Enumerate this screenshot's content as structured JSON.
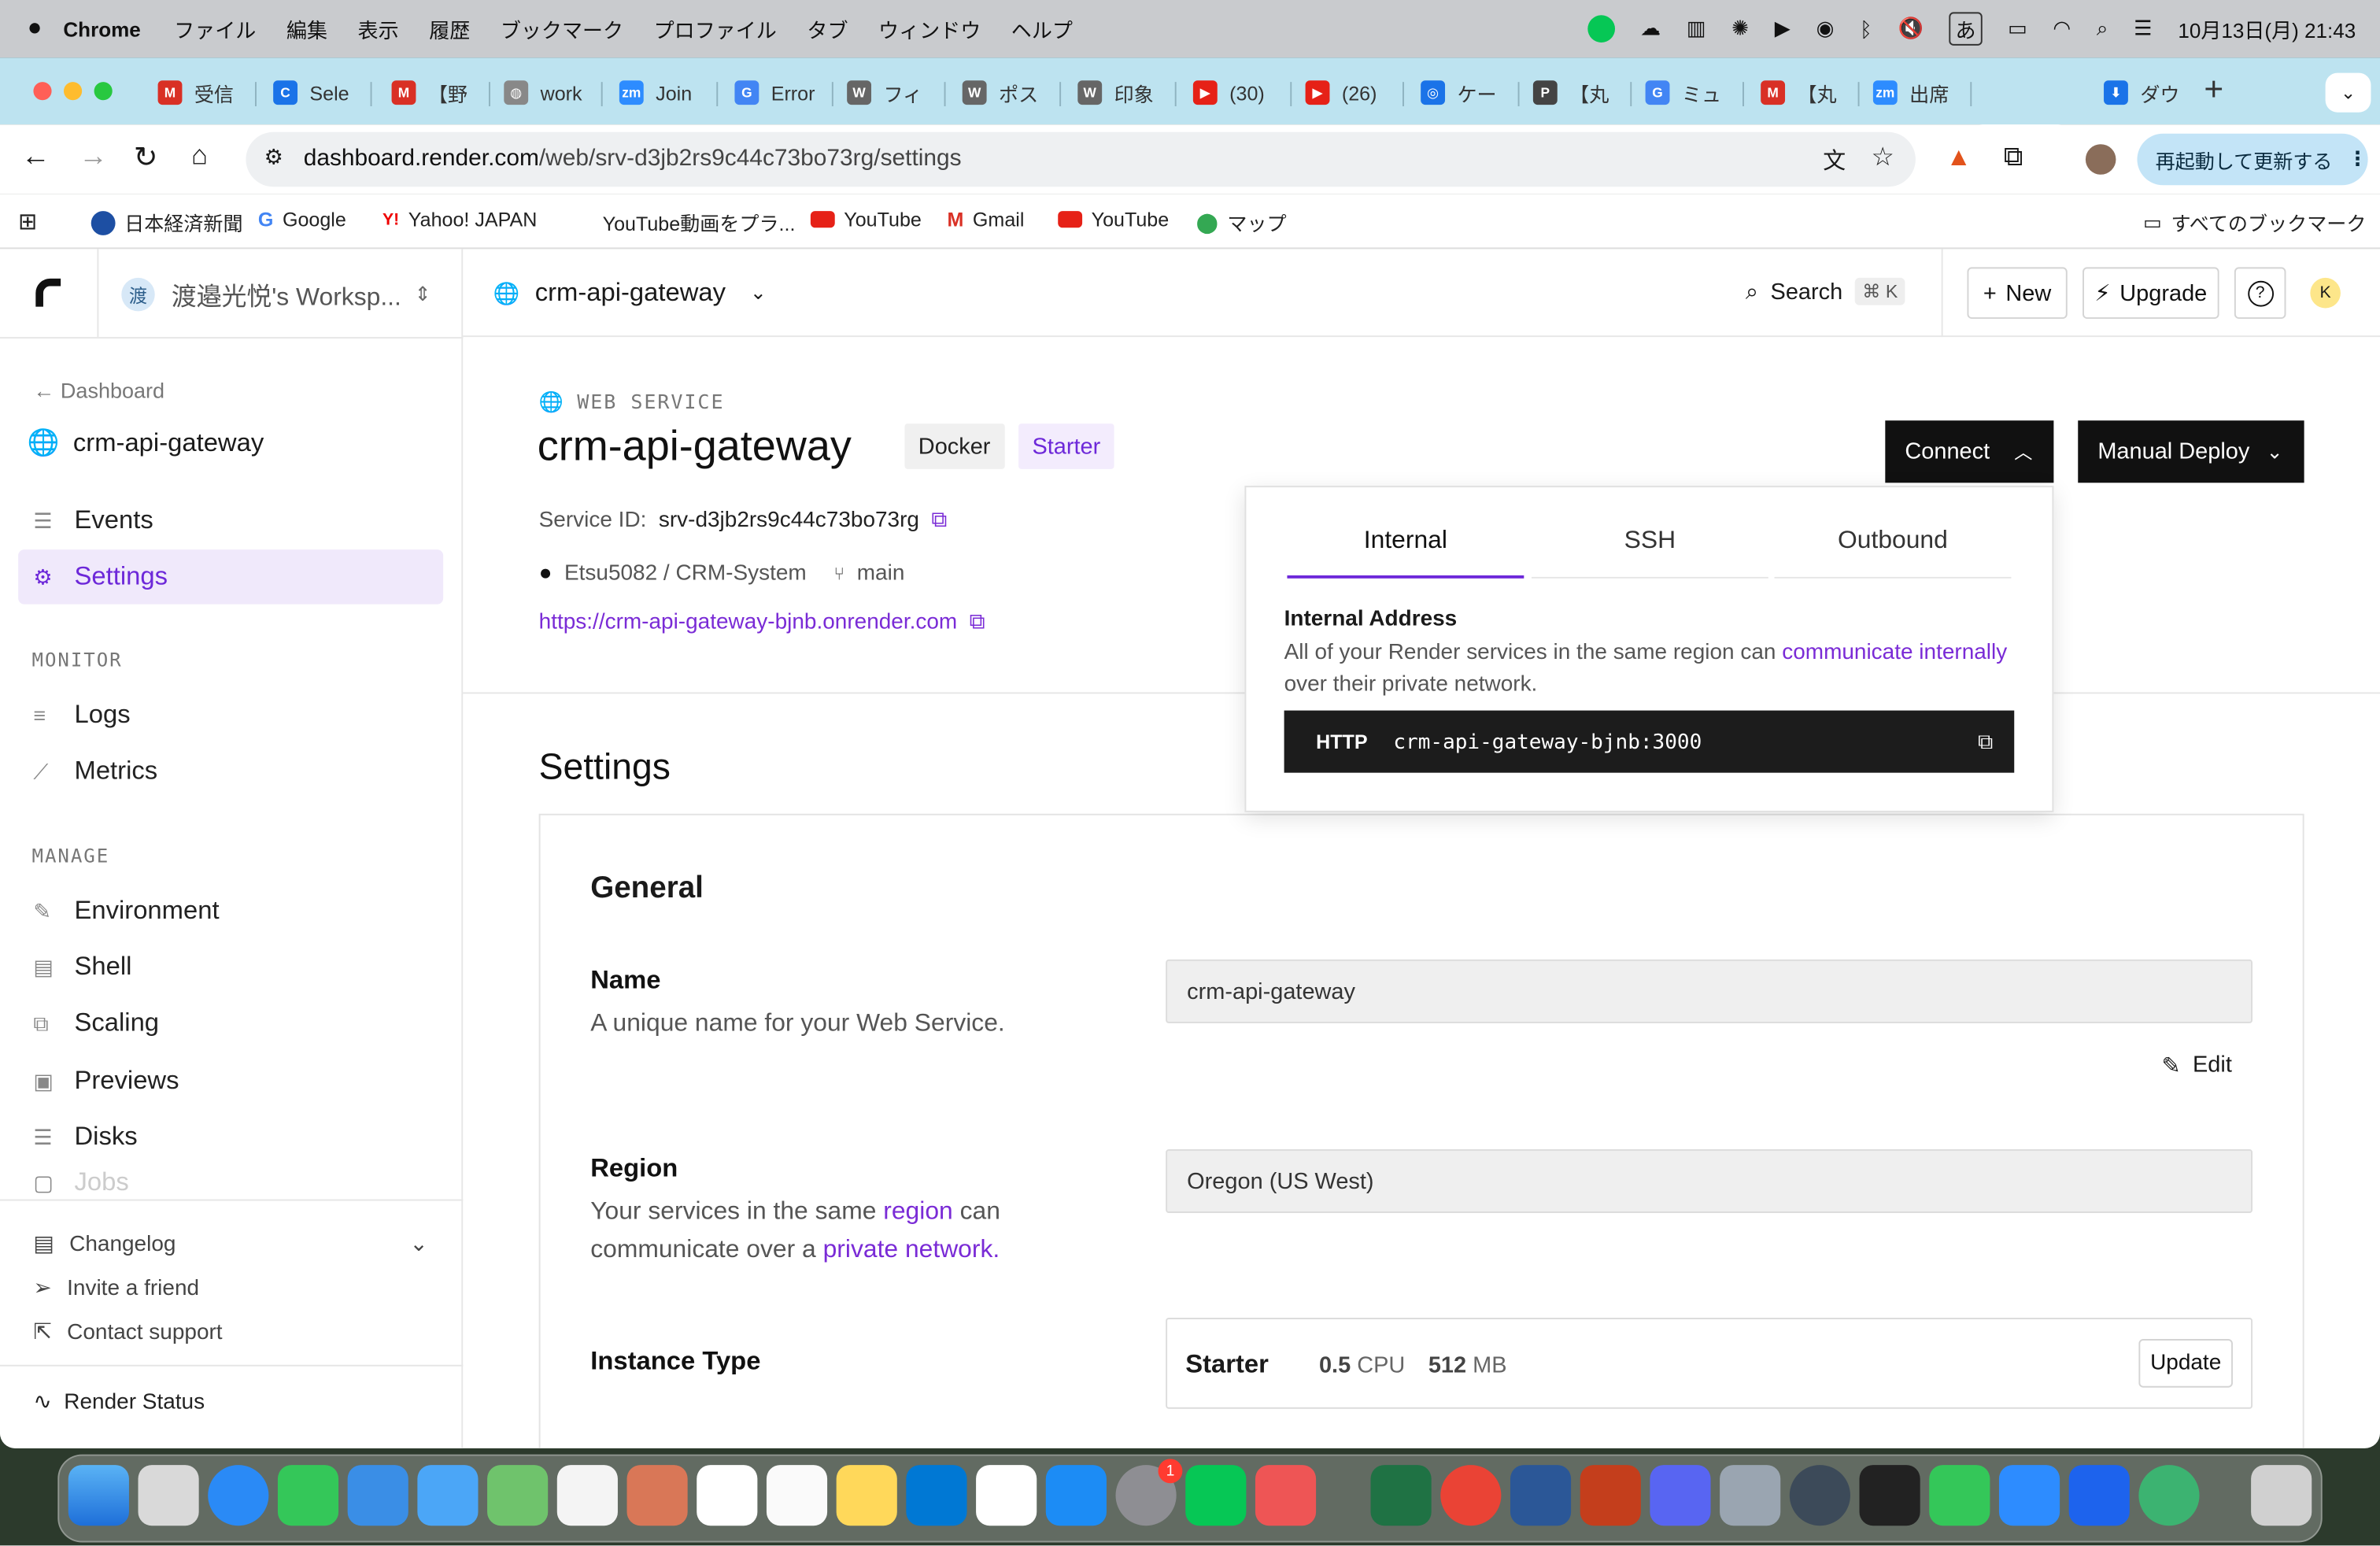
{
  "menubar": {
    "app": "Chrome",
    "items": [
      "ファイル",
      "編集",
      "表示",
      "履歴",
      "ブックマーク",
      "プロファイル",
      "タブ",
      "ウィンドウ",
      "ヘルプ"
    ],
    "ime": "あ",
    "clock": "10月13日(月)  21:43"
  },
  "tabs": [
    {
      "label": "受信",
      "fav": "M",
      "color": "#d93025"
    },
    {
      "label": "Sele",
      "fav": "C",
      "color": "#1a73e8"
    },
    {
      "label": "【野",
      "fav": "M",
      "color": "#d93025"
    },
    {
      "label": "work",
      "fav": "◍",
      "color": "#888"
    },
    {
      "label": "Join",
      "fav": "zm",
      "color": "#2d8cff"
    },
    {
      "label": "Error",
      "fav": "G",
      "color": "#4285f4"
    },
    {
      "label": "フィ",
      "fav": "W",
      "color": "#666"
    },
    {
      "label": "ポス",
      "fav": "W",
      "color": "#666"
    },
    {
      "label": "印象",
      "fav": "W",
      "color": "#666"
    },
    {
      "label": "(30)",
      "fav": "▶",
      "color": "#e62117"
    },
    {
      "label": "(26)",
      "fav": "▶",
      "color": "#e62117"
    },
    {
      "label": "ケー",
      "fav": "◎",
      "color": "#1a73e8"
    },
    {
      "label": "【丸",
      "fav": "P",
      "color": "#444"
    },
    {
      "label": "ミュ",
      "fav": "G",
      "color": "#4285f4"
    },
    {
      "label": "【丸",
      "fav": "M",
      "color": "#d93025"
    },
    {
      "label": "出席",
      "fav": "zm",
      "color": "#2d8cff"
    },
    {
      "label": "(",
      "fav": "▞",
      "color": "#111"
    },
    {
      "label": "ダウ",
      "fav": "⬇",
      "color": "#1a73e8"
    }
  ],
  "toolbar": {
    "url_host": "dashboard.render.com",
    "url_path": "/web/srv-d3jb2rs9c44c73bo73rg/settings",
    "restart": "再起動して更新する"
  },
  "bookmarks": [
    "日本経済新聞",
    "Google",
    "Yahoo! JAPAN",
    "YouTube動画をプラ...",
    "YouTube",
    "Gmail",
    "YouTube",
    "マップ"
  ],
  "bookmarks_all": "すべてのブックマーク",
  "workspace": {
    "initial": "渡",
    "name": "渡邉光悦's Worksp..."
  },
  "topbar": {
    "service": "crm-api-gateway",
    "search": "Search",
    "shortcut": "⌘ K",
    "new": "New",
    "upgrade": "Upgrade",
    "help": "?",
    "avatar": "K"
  },
  "sidebar": {
    "back": "Dashboard",
    "service": "crm-api-gateway",
    "events": "Events",
    "settings": "Settings",
    "monitor": "MONITOR",
    "logs": "Logs",
    "metrics": "Metrics",
    "manage": "MANAGE",
    "environment": "Environment",
    "shell": "Shell",
    "scaling": "Scaling",
    "previews": "Previews",
    "disks": "Disks",
    "jobs": "Jobs",
    "changelog": "Changelog",
    "invite": "Invite a friend",
    "support": "Contact support",
    "status": "Render Status"
  },
  "service": {
    "type": "WEB SERVICE",
    "name": "crm-api-gateway",
    "tag_runtime": "Docker",
    "tag_plan": "Starter",
    "id_label": "Service ID:",
    "id": "srv-d3jb2rs9c44c73bo73rg",
    "repo": "Etsu5082 / CRM-System",
    "branch": "main",
    "url": "https://crm-api-gateway-bjnb.onrender.com"
  },
  "actions": {
    "connect": "Connect",
    "deploy": "Manual Deploy"
  },
  "popover": {
    "tabs": [
      "Internal",
      "SSH",
      "Outbound"
    ],
    "title": "Internal Address",
    "desc_pre": "All of your Render services in the same region can ",
    "desc_link": "communicate internally",
    "desc_post": " over their private network.",
    "protocol": "HTTP",
    "address": "crm-api-gateway-bjnb:3000"
  },
  "settings": {
    "heading": "Settings",
    "general": "General",
    "name_label": "Name",
    "name_desc": "A unique name for your Web Service.",
    "name_value": "crm-api-gateway",
    "edit": "Edit",
    "region_label": "Region",
    "region_d1": "Your services in the same ",
    "region_link1": "region",
    "region_d2": " can communicate over a ",
    "region_link2": "private network.",
    "region_value": "Oregon (US West)",
    "instance_label": "Instance Type",
    "instance_name": "Starter",
    "cpu_val": "0.5",
    "cpu_unit": "CPU",
    "mem_val": "512",
    "mem_unit": "MB",
    "update": "Update"
  },
  "dock": {
    "badge_settings": "1"
  }
}
